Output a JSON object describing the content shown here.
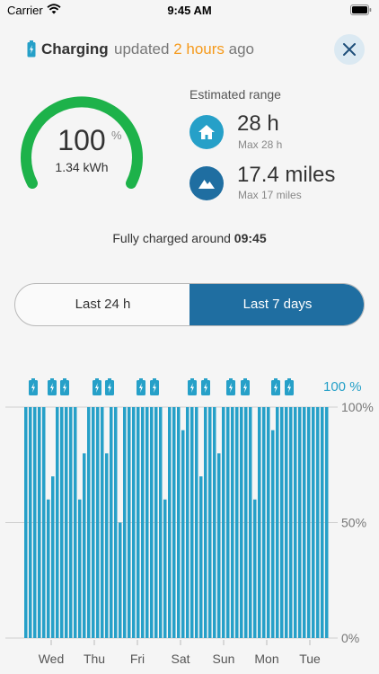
{
  "status_bar": {
    "carrier": "Carrier",
    "time": "9:45 AM"
  },
  "header": {
    "title": "Charging",
    "updated_prefix": "updated",
    "updated_value": "2 hours",
    "updated_suffix": "ago"
  },
  "gauge": {
    "percent": "100",
    "percent_unit": "%",
    "energy": "1.34 kWh",
    "level": 1.0,
    "color": "#1db24a"
  },
  "range": {
    "title": "Estimated range",
    "home": {
      "value": "28 h",
      "max": "Max 28 h",
      "icon": "home-icon",
      "color": "#26a0c8"
    },
    "travel": {
      "value": "17.4 miles",
      "max": "Max 17 miles",
      "icon": "mountain-icon",
      "color": "#1f6ea1"
    }
  },
  "full_note": {
    "prefix": "Fully charged around",
    "time": "09:45"
  },
  "segments": {
    "last_24h": "Last 24 h",
    "last_7d": "Last 7 days",
    "selected": "last_7d"
  },
  "colors": {
    "accent": "#26a0c8",
    "dark_blue": "#1f6ea1",
    "orange": "#f59a1c"
  },
  "chart_data": {
    "type": "bar",
    "label_top": "100 %",
    "y_ticks": [
      "100%",
      "50%",
      "0%"
    ],
    "ylim": [
      0,
      100
    ],
    "x_labels": [
      "Wed",
      "Thu",
      "Fri",
      "Sat",
      "Sun",
      "Mon",
      "Tue"
    ],
    "values": [
      100,
      100,
      100,
      100,
      100,
      60,
      70,
      100,
      100,
      100,
      100,
      100,
      60,
      80,
      100,
      100,
      100,
      100,
      80,
      100,
      100,
      50,
      100,
      100,
      100,
      100,
      100,
      100,
      100,
      100,
      100,
      60,
      100,
      100,
      100,
      90,
      100,
      100,
      100,
      70,
      100,
      100,
      100,
      80,
      100,
      100,
      100,
      100,
      100,
      100,
      100,
      60,
      100,
      100,
      100,
      90,
      100,
      100,
      100,
      100,
      100,
      100,
      100,
      100,
      100,
      100,
      100,
      100
    ],
    "charge_markers_count": 14
  }
}
